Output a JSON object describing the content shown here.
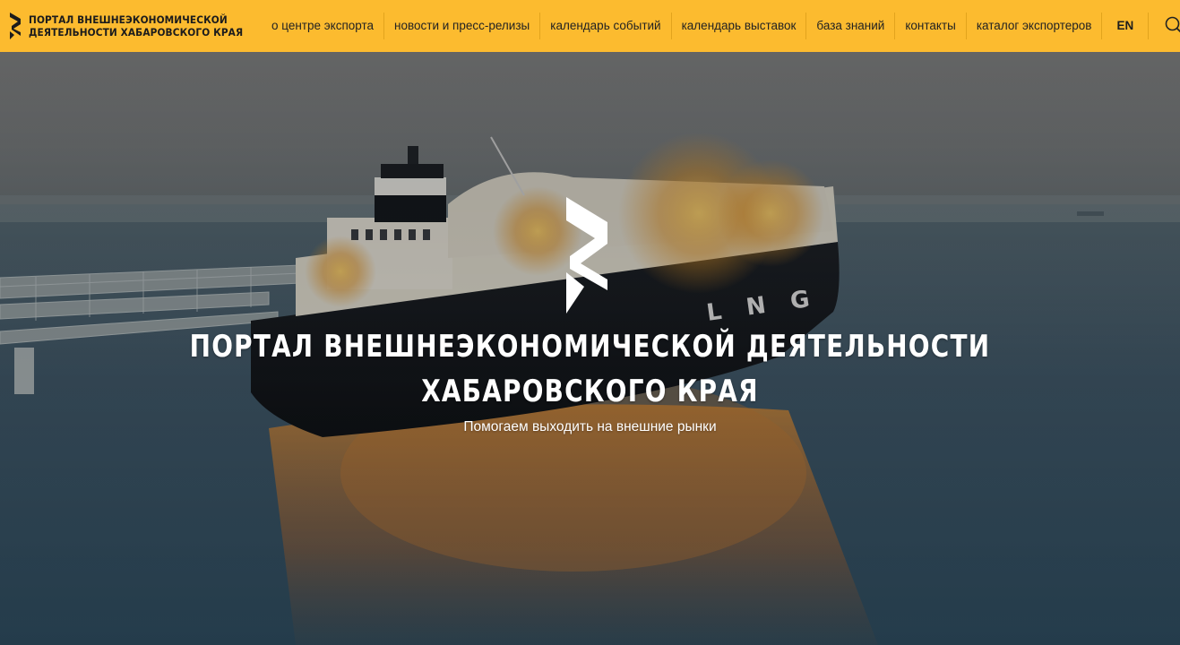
{
  "header": {
    "logo_line1": "ПОРТАЛ ВНЕШНЕЭКОНОМИЧЕСКОЙ",
    "logo_line2": "ДЕЯТЕЛЬНОСТИ ХАБАРОВСКОГО КРАЯ",
    "nav": [
      {
        "label": "о центре экспорта"
      },
      {
        "label": "новости и пресс-релизы"
      },
      {
        "label": "календарь событий"
      },
      {
        "label": "календарь выставок"
      },
      {
        "label": "база знаний"
      },
      {
        "label": "контакты"
      },
      {
        "label": "каталог экспортеров"
      }
    ],
    "lang": "EN",
    "search_icon": "search-icon",
    "accent_color": "#fcbb2f"
  },
  "hero": {
    "title_line1": "ПОРТАЛ ВНЕШНЕЭКОНОМИЧЕСКОЙ ДЕЯТЕЛЬНОСТИ",
    "title_line2": "ХАБАРОВСКОГО КРАЯ",
    "subtitle": "Помогаем выходить на внешние рынки",
    "ship_hull_lettering": "LNG",
    "background_image": "lng-tanker-photo"
  }
}
